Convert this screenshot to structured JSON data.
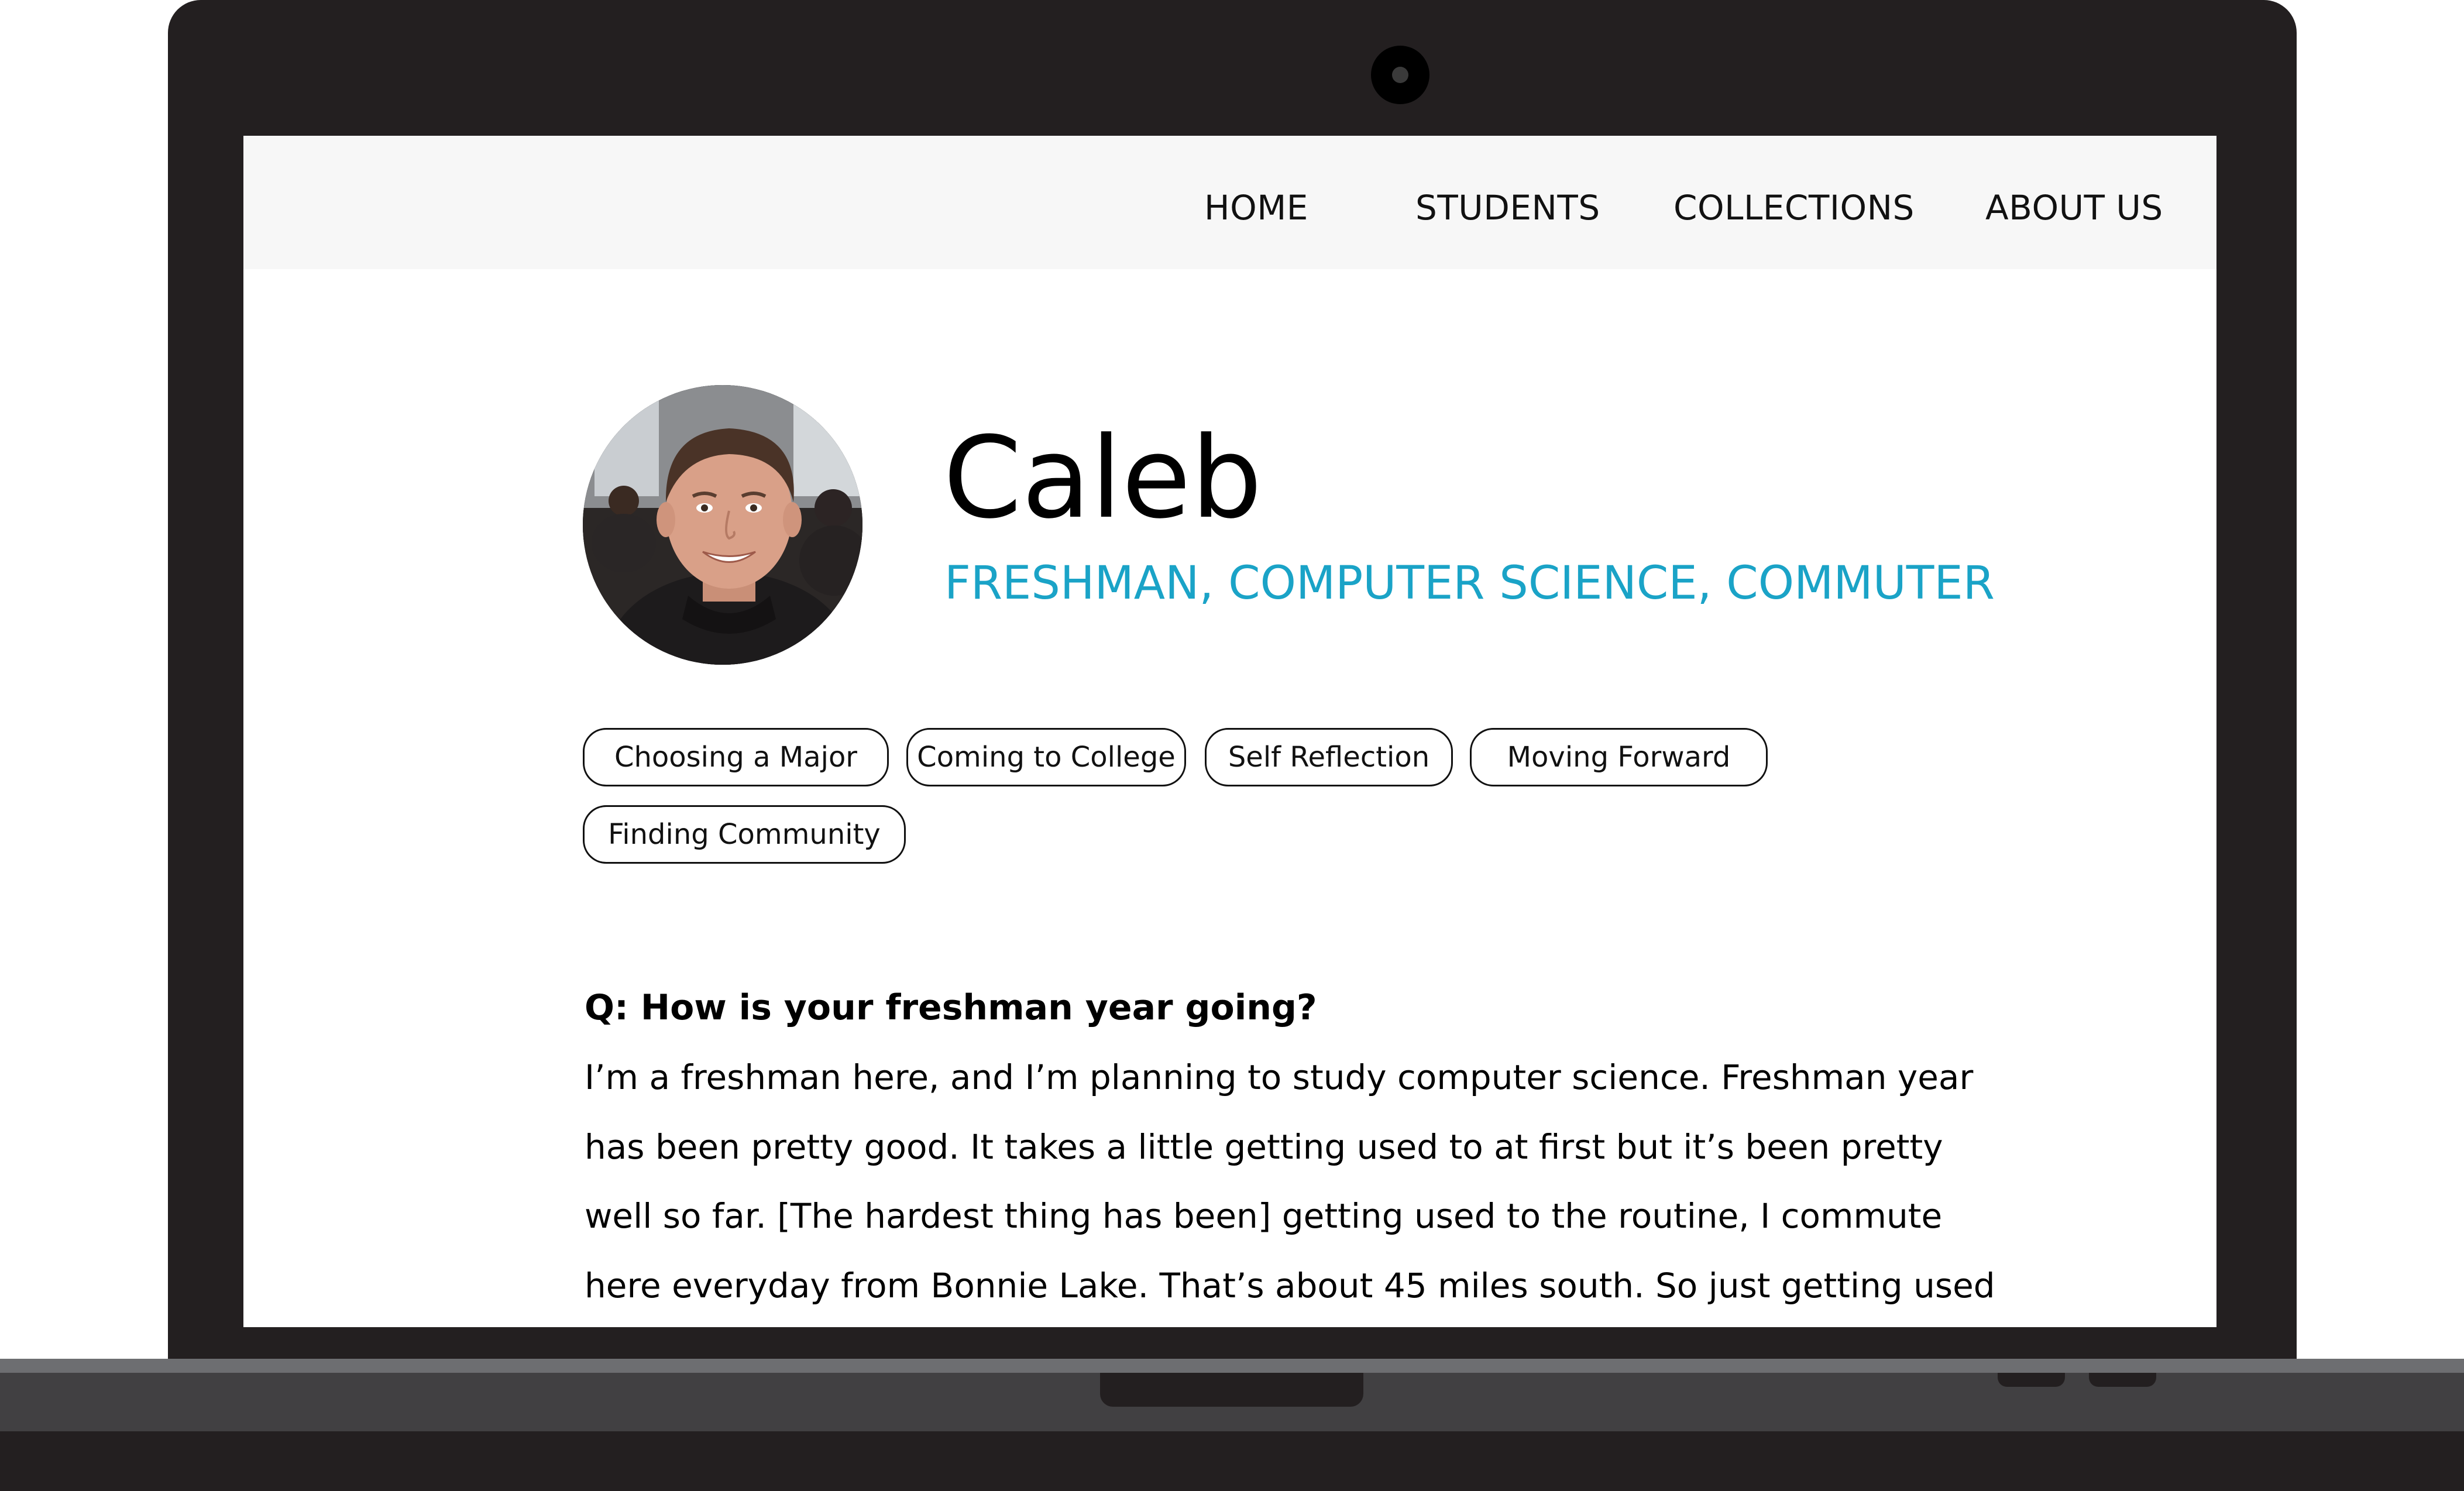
{
  "nav": {
    "items": [
      "HOME",
      "STUDENTS",
      "COLLECTIONS",
      "ABOUT US"
    ]
  },
  "profile": {
    "name": "Caleb",
    "subtitle": "FRESHMAN, COMPUTER SCIENCE, COMMUTER",
    "accent_color": "#1aa3c7"
  },
  "tags": [
    "Choosing a Major",
    "Coming to College",
    "Self Reflection",
    "Moving Forward",
    "Finding Community"
  ],
  "article": {
    "question": "Q: How is your freshman year going?",
    "answer_lines": [
      "I’m a freshman here, and I’m planning to study computer science.  Freshman year",
      "has been pretty good. It takes a little getting used to at first but it’s been pretty",
      "well so far. [The hardest thing has been] getting used to the routine, I commute",
      "here everyday from Bonnie Lake. That’s about 45 miles south. So just getting used"
    ]
  }
}
